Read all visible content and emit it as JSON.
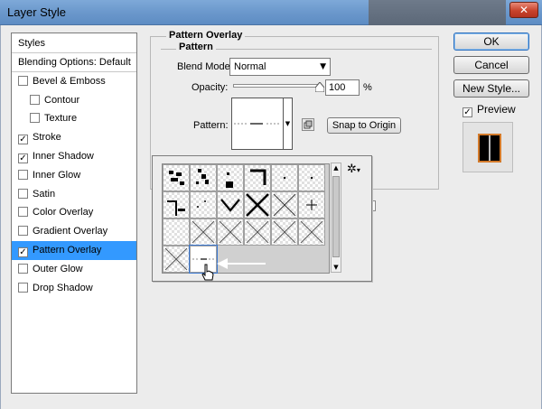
{
  "window": {
    "title": "Layer Style",
    "close_glyph": "✕"
  },
  "styles": {
    "header": "Styles",
    "blending_options": "Blending Options: Default",
    "items": [
      {
        "label": "Bevel & Emboss",
        "checked": false,
        "sub": false
      },
      {
        "label": "Contour",
        "checked": false,
        "sub": true
      },
      {
        "label": "Texture",
        "checked": false,
        "sub": true
      },
      {
        "label": "Stroke",
        "checked": true,
        "sub": false
      },
      {
        "label": "Inner Shadow",
        "checked": true,
        "sub": false
      },
      {
        "label": "Inner Glow",
        "checked": false,
        "sub": false
      },
      {
        "label": "Satin",
        "checked": false,
        "sub": false
      },
      {
        "label": "Color Overlay",
        "checked": false,
        "sub": false
      },
      {
        "label": "Gradient Overlay",
        "checked": false,
        "sub": false
      },
      {
        "label": "Pattern Overlay",
        "checked": true,
        "sub": false,
        "selected": true
      },
      {
        "label": "Outer Glow",
        "checked": false,
        "sub": false
      },
      {
        "label": "Drop Shadow",
        "checked": false,
        "sub": false
      }
    ]
  },
  "pattern_overlay": {
    "group_title": "Pattern Overlay",
    "section_title": "Pattern",
    "blend_mode_label": "Blend Mode:",
    "blend_mode_value": "Normal",
    "opacity_label": "Opacity:",
    "opacity_value": "100",
    "opacity_unit": "%",
    "opacity_fraction": 1.0,
    "pattern_label": "Pattern:",
    "snap_button": "Snap to Origin"
  },
  "buttons": {
    "ok": "OK",
    "cancel": "Cancel",
    "new_style": "New Style...",
    "preview_label": "Preview",
    "preview_checked": true
  },
  "picker": {
    "gear_glyph": "✲",
    "scroll_up": "▲",
    "scroll_down": "▼",
    "cell_count": 20
  },
  "colors": {
    "selected_row": "#3399ff",
    "title_bar": "#6b98cc",
    "close_button": "#c8432c",
    "preview_border": "#d37a2a"
  }
}
